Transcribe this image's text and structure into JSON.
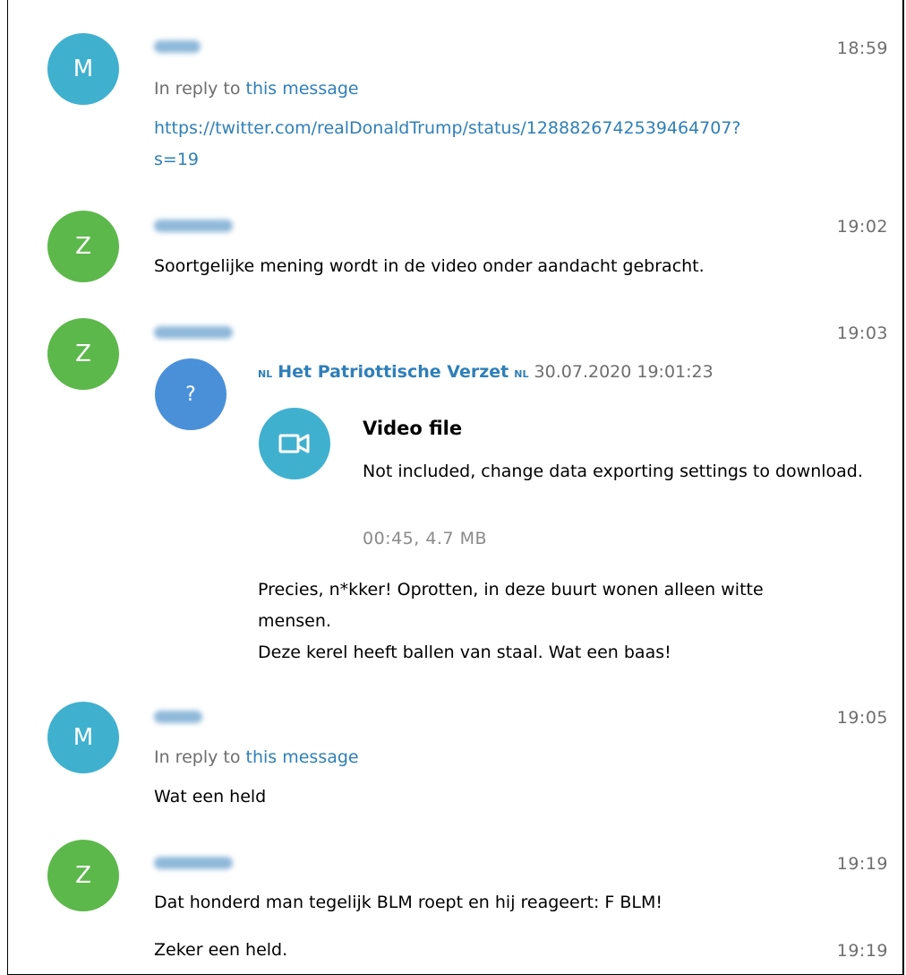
{
  "messages": [
    {
      "avatar_letter": "M",
      "avatar_color": "#40b0cf",
      "time": "18:59",
      "reply_prefix": "In reply to",
      "reply_link": "this message",
      "link_line1": "https://twitter.com/realDonaldTrump/status/1288826742539464707?",
      "link_line2": "s=19"
    },
    {
      "avatar_letter": "Z",
      "avatar_color": "#5cb84a",
      "time": "19:02",
      "text": "Soortgelijke mening wordt in de video onder aandacht gebracht."
    },
    {
      "avatar_letter": "Z",
      "avatar_color": "#5cb84a",
      "time": "19:03",
      "forward": {
        "avatar_glyph": "?",
        "flag_left": "NL",
        "from": "Het Patriottische Verzet",
        "flag_right": "NL",
        "date": "30.07.2020 19:01:23",
        "media_icon": "video-camera-icon",
        "media_title": "Video file",
        "media_desc": "Not included, change data exporting settings to download.",
        "media_size": "00:45, 4.7 MB",
        "text_line1": "Precies, n*kker! Oprotten, in deze buurt wonen alleen witte",
        "text_line2": "mensen.",
        "text_line3": "Deze kerel heeft ballen van staal. Wat een baas!"
      }
    },
    {
      "avatar_letter": "M",
      "avatar_color": "#40b0cf",
      "time": "19:05",
      "reply_prefix": "In reply to",
      "reply_link": "this message",
      "text": "Wat een held"
    },
    {
      "avatar_letter": "Z",
      "avatar_color": "#5cb84a",
      "time": "19:19",
      "text": "Dat honderd man tegelijk BLM roept en hij reageert: F BLM!"
    },
    {
      "time": "19:19",
      "text": "Zeker een held."
    }
  ]
}
